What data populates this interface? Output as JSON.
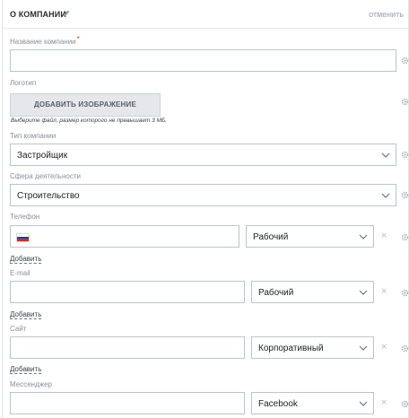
{
  "header": {
    "title": "О КОМПАНИИ",
    "cancel_label": "отменить"
  },
  "company_name": {
    "label": "Название компании",
    "required_mark": "*",
    "value": ""
  },
  "logo": {
    "label": "Логотип",
    "button_label": "ДОБАВИТЬ ИЗОБРАЖЕНИЕ",
    "hint": "Выберите файл, размер которого не превышает 3 МБ."
  },
  "company_type": {
    "label": "Тип компании",
    "selected": "Застройщик"
  },
  "industry": {
    "label": "Сфера деятельности",
    "selected": "Строительство"
  },
  "phone": {
    "label": "Телефон",
    "value": "",
    "type_selected": "Рабочий",
    "add_label": "Добавить",
    "country_flag_colors": [
      "#ffffff",
      "#1c3faa",
      "#d52b1e"
    ]
  },
  "email": {
    "label": "E-mail",
    "value": "",
    "type_selected": "Рабочий",
    "add_label": "Добавить"
  },
  "site": {
    "label": "Сайт",
    "value": "",
    "type_selected": "Корпоративный",
    "add_label": "Добавить"
  },
  "messenger": {
    "label": "Мессенджер",
    "value": "",
    "type_selected": "Facebook"
  },
  "icons": {
    "remove": "×"
  }
}
